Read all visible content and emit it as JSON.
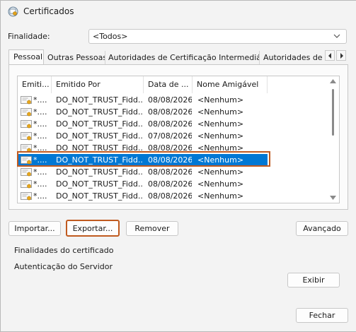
{
  "window": {
    "title": "Certificados"
  },
  "purpose": {
    "label": "Finalidade:",
    "value": "<Todos>"
  },
  "tabs": [
    {
      "label": "Pessoal",
      "active": true
    },
    {
      "label": "Outras Pessoas"
    },
    {
      "label": "Autoridades de Certificação Intermediárias"
    },
    {
      "label": "Autoridades de Ce"
    }
  ],
  "list": {
    "columns": [
      "Emiti...",
      "Emitido Por",
      "Data de ...",
      "Nome Amigável"
    ],
    "rows": [
      {
        "issued_to": "*....",
        "issued_by": "DO_NOT_TRUST_Fidd...",
        "date": "08/08/2026",
        "friendly": "<Nenhum>"
      },
      {
        "issued_to": "*....",
        "issued_by": "DO_NOT_TRUST_Fidd...",
        "date": "08/08/2026",
        "friendly": "<Nenhum>"
      },
      {
        "issued_to": "*....",
        "issued_by": "DO_NOT_TRUST_Fidd...",
        "date": "08/08/2026",
        "friendly": "<Nenhum>"
      },
      {
        "issued_to": "*....",
        "issued_by": "DO_NOT_TRUST_Fidd...",
        "date": "07/08/2026",
        "friendly": "<Nenhum>"
      },
      {
        "issued_to": "*....",
        "issued_by": "DO_NOT_TRUST_Fidd...",
        "date": "08/08/2026",
        "friendly": "<Nenhum>"
      },
      {
        "issued_to": "*....",
        "issued_by": "DO_NOT_TRUST_Fidd...",
        "date": "08/08/2026",
        "friendly": "<Nenhum>",
        "selected": true
      },
      {
        "issued_to": "*....",
        "issued_by": "DO_NOT_TRUST_Fidd...",
        "date": "08/08/2026",
        "friendly": "<Nenhum>"
      },
      {
        "issued_to": "*....",
        "issued_by": "DO_NOT_TRUST_Fidd...",
        "date": "08/08/2026",
        "friendly": "<Nenhum>"
      },
      {
        "issued_to": "*....",
        "issued_by": "DO_NOT_TRUST_Fidd...",
        "date": "08/08/2026",
        "friendly": "<Nenhum>"
      }
    ]
  },
  "buttons": {
    "import": "Importar...",
    "export": "Exportar...",
    "remove": "Remover",
    "advanced": "Avançado",
    "view": "Exibir",
    "close": "Fechar"
  },
  "purposes_group": {
    "title": "Finalidades do certificado",
    "value": "Autenticação do Servidor"
  },
  "colors": {
    "selection": "#0078d4",
    "highlight": "#c05a1f"
  },
  "icons": {
    "app": "certificate-app-icon",
    "row": "certificate-icon",
    "dropdown": "chevron-down-icon"
  }
}
